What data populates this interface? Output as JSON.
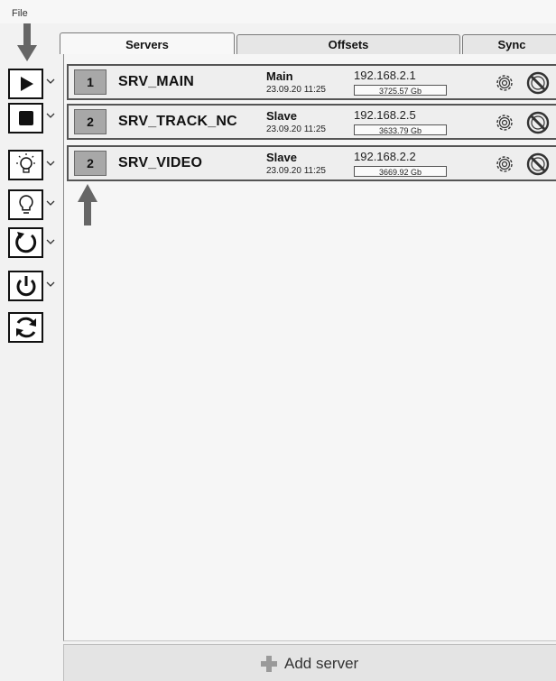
{
  "menu": {
    "file": "File"
  },
  "tabs": [
    {
      "label": "Servers",
      "active": true
    },
    {
      "label": "Offsets",
      "active": false
    },
    {
      "label": "Sync",
      "active": false
    }
  ],
  "toolbar": [
    {
      "icon": "play-icon",
      "has_dropdown": true
    },
    {
      "icon": "stop-icon",
      "has_dropdown": true
    },
    {
      "icon": "lightbulb-on-icon",
      "has_dropdown": true
    },
    {
      "icon": "lightbulb-off-icon",
      "has_dropdown": true
    },
    {
      "icon": "restart-icon",
      "has_dropdown": true
    },
    {
      "icon": "power-icon",
      "has_dropdown": true
    },
    {
      "icon": "refresh-icon",
      "has_dropdown": false
    }
  ],
  "servers": [
    {
      "number": "1",
      "name": "SRV_MAIN",
      "role": "Main",
      "date": "23.09.20 11:25",
      "ip": "192.168.2.1",
      "disk": "3725.57 Gb"
    },
    {
      "number": "2",
      "name": "SRV_TRACK_NC",
      "role": "Slave",
      "date": "23.09.20 11:25",
      "ip": "192.168.2.5",
      "disk": "3633.79 Gb"
    },
    {
      "number": "2",
      "name": "SRV_VIDEO",
      "role": "Slave",
      "date": "23.09.20 11:25",
      "ip": "192.168.2.2",
      "disk": "3669.92 Gb"
    }
  ],
  "add_server": {
    "label": "Add server",
    "icon": "plus-icon"
  },
  "colors": {
    "row_number_bg": "#a8a8a8",
    "callout_arrow": "#666666"
  }
}
